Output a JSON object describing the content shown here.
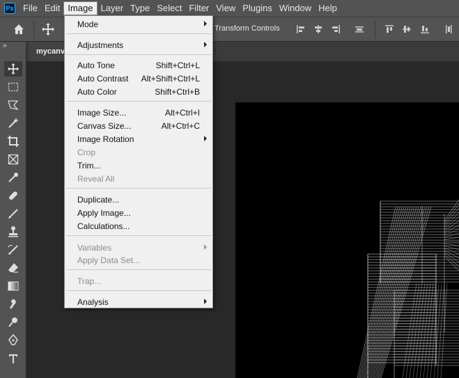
{
  "app": {
    "logo_text": "Ps"
  },
  "menubar": {
    "items": [
      "File",
      "Edit",
      "Image",
      "Layer",
      "Type",
      "Select",
      "Filter",
      "View",
      "Plugins",
      "Window",
      "Help"
    ],
    "active": "Image"
  },
  "options": {
    "transform_controls": "Transform Controls"
  },
  "document": {
    "tab_title": "mycanv"
  },
  "image_menu": {
    "mode": "Mode",
    "adjustments": "Adjustments",
    "auto_tone": "Auto Tone",
    "auto_tone_sc": "Shift+Ctrl+L",
    "auto_contrast": "Auto Contrast",
    "auto_contrast_sc": "Alt+Shift+Ctrl+L",
    "auto_color": "Auto Color",
    "auto_color_sc": "Shift+Ctrl+B",
    "image_size": "Image Size...",
    "image_size_sc": "Alt+Ctrl+I",
    "canvas_size": "Canvas Size...",
    "canvas_size_sc": "Alt+Ctrl+C",
    "image_rotation": "Image Rotation",
    "crop": "Crop",
    "trim": "Trim...",
    "reveal_all": "Reveal All",
    "duplicate": "Duplicate...",
    "apply_image": "Apply Image...",
    "calculations": "Calculations...",
    "variables": "Variables",
    "apply_data_set": "Apply Data Set...",
    "trap": "Trap...",
    "analysis": "Analysis"
  },
  "colors": {
    "menu_bg": "#f0f0f0",
    "chrome": "#535353",
    "workspace": "#282828",
    "accent": "#31a8ff"
  }
}
